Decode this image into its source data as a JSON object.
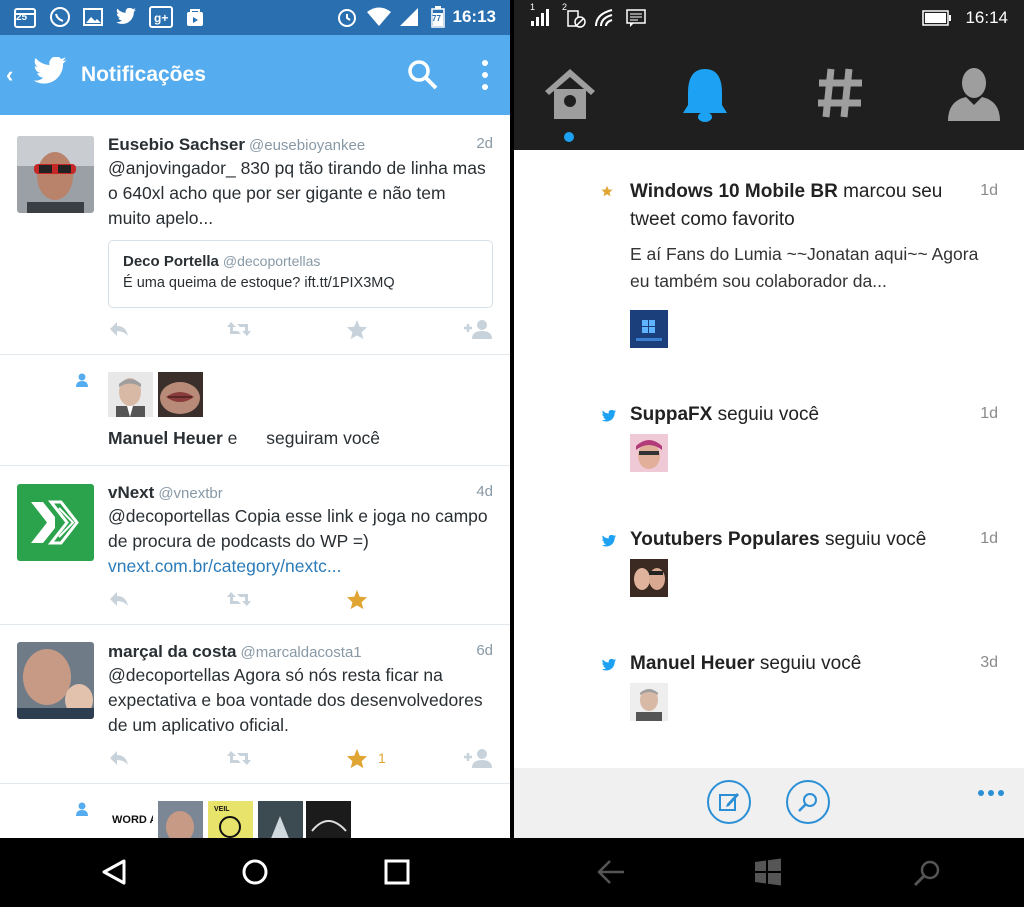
{
  "android": {
    "status": {
      "calendar_day": "25",
      "battery": "77",
      "time": "16:13"
    },
    "app_bar": {
      "title": "Notificações"
    },
    "items": [
      {
        "name": "Eusebio Sachser",
        "handle": "@eusebioyankee",
        "ago": "2d",
        "text": "@anjovingador_ 830 pq tão tirando de linha mas o 640xl acho que por ser gigante e não tem muito apelo...",
        "quote": {
          "name": "Deco Portella",
          "handle": "@decoportellas",
          "text": "É uma queima de estoque? ift.tt/1PIX3MQ"
        }
      },
      {
        "follow_name": "Manuel Heuer",
        "follow_connector": "e",
        "follow_suffix": "seguiram você"
      },
      {
        "name": "vNext",
        "handle": "@vnextbr",
        "ago": "4d",
        "text": "@decoportellas Copia esse link e joga no campo de procura de podcasts do WP =)",
        "link": "vnext.com.br/category/nextc..."
      },
      {
        "name": "marçal da costa",
        "handle": "@marcaldacosta1",
        "ago": "6d",
        "text": "@decoportellas Agora só nós resta ficar na expectativa e boa vontade dos desenvolvedores de um aplicativo oficial.",
        "fav_count": "1"
      },
      {
        "thumb1_text": "WORD ALIVE",
        "thumb3_text": "VEIL"
      }
    ]
  },
  "wp": {
    "status": {
      "signal1": "1",
      "signal2": "2",
      "time": "16:14"
    },
    "items": [
      {
        "name": "Windows 10 Mobile BR",
        "action": "marcou seu tweet como favorito",
        "ago": "1d",
        "desc": "E aí Fans do Lumia ~~Jonatan aqui~~ Agora eu também sou colaborador da..."
      },
      {
        "name": "SuppaFX",
        "action": "seguiu você",
        "ago": "1d"
      },
      {
        "name": "Youtubers Populares",
        "action": "seguiu você",
        "ago": "1d"
      },
      {
        "name": "Manuel Heuer",
        "action": "seguiu você",
        "ago": "3d"
      }
    ]
  },
  "colors": {
    "twitter_blue": "#55acee",
    "star": "#e0a533",
    "link": "#2b7bb9"
  }
}
